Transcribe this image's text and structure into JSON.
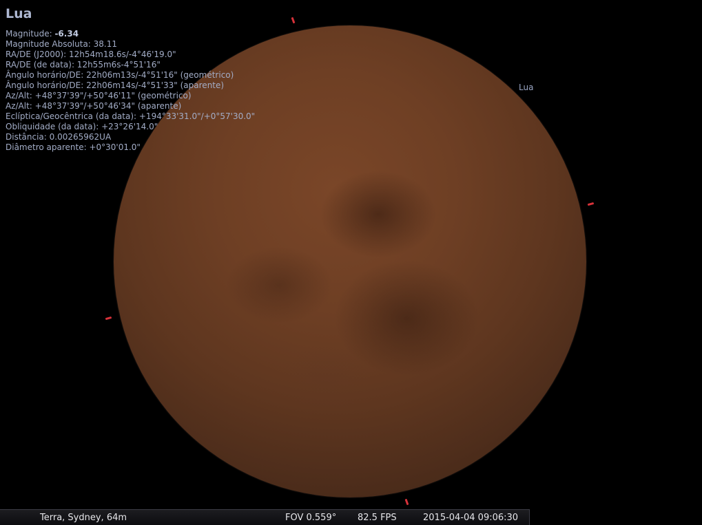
{
  "object_info": {
    "title": "Lua",
    "magnitude_label": "Magnitude:",
    "magnitude_value": "-6.34",
    "lines": [
      "Magnitude Absoluta: 38.11",
      "RA/DE (J2000): 12h54m18.6s/-4°46'19.0\"",
      "RA/DE (de data): 12h55m6s-4°51'16\"",
      "Ângulo horário/DE: 22h06m13s/-4°51'16\" (geométrico)",
      "Ângulo horário/DE: 22h06m14s/-4°51'33\" (aparente)",
      "Az/Alt: +48°37'39\"/+50°46'11\" (geométrico)",
      "Az/Alt: +48°37'39\"/+50°46'34\" (aparente)",
      "Eclíptica/Geocêntrica (da data): +194°33'31.0\"/+0°57'30.0\"",
      "Obliquidade (da data): +23°26'14.0\"",
      "Distância: 0.00265962UA",
      "Diâmetro aparente: +0°30'01.0\""
    ]
  },
  "sky": {
    "object_label": "Lua",
    "selection_marker_color": "#d8323a",
    "moon_color": "#6e3f24"
  },
  "status_bar": {
    "location": "Terra, Sydney, 64m",
    "fov": "FOV 0.559°",
    "fps": "82.5 FPS",
    "datetime": "2015-04-04   09:06:30"
  }
}
